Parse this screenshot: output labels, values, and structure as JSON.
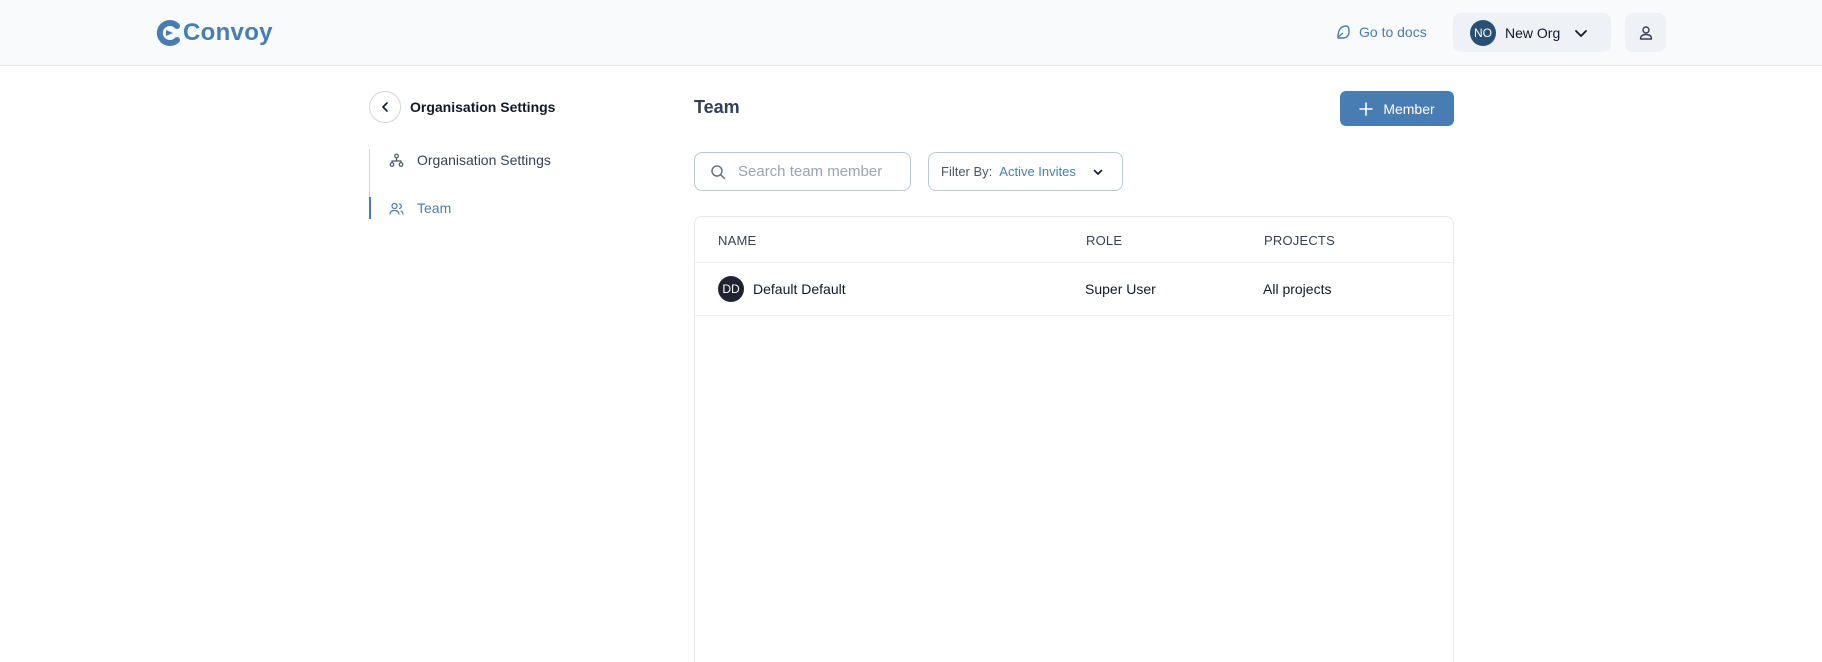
{
  "header": {
    "logo_text": "Convoy",
    "docs_label": "Go to docs",
    "org": {
      "initials": "NO",
      "name": "New Org"
    }
  },
  "sidebar": {
    "back_title": "Organisation Settings",
    "items": [
      {
        "label": "Organisation Settings",
        "icon": "organisation-icon",
        "active": false
      },
      {
        "label": "Team",
        "icon": "team-icon",
        "active": true
      }
    ]
  },
  "main": {
    "title": "Team",
    "add_member_label": "Member",
    "search": {
      "placeholder": "Search team member",
      "value": ""
    },
    "filter": {
      "label": "Filter By:",
      "value": "Active Invites"
    },
    "table": {
      "columns": [
        "NAME",
        "ROLE",
        "PROJECTS"
      ],
      "rows": [
        {
          "initials": "DD",
          "name": "Default Default",
          "role": "Super User",
          "projects": "All projects"
        }
      ]
    }
  },
  "colors": {
    "accent": "#477db3",
    "org_avatar": "#2b4e74",
    "row_avatar": "#1f2230"
  }
}
